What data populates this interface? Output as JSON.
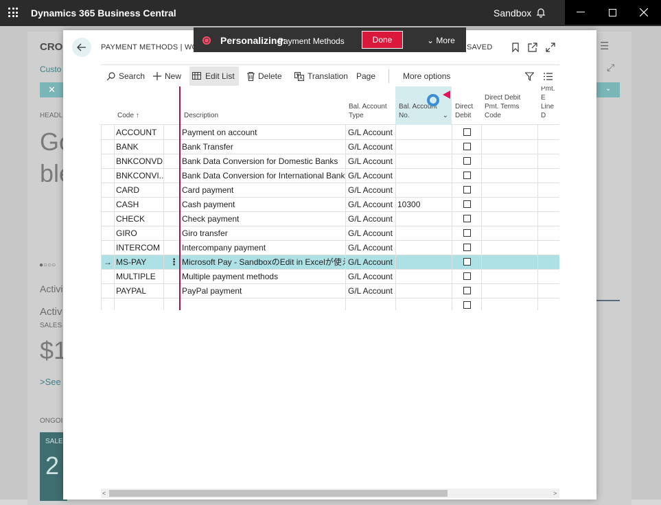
{
  "titlebar": {
    "app_title": "Dynamics 365 Business Central",
    "environment": "Sandbox",
    "icons": [
      "app-launcher-icon",
      "bell-icon",
      "minimize-icon",
      "maximize-icon",
      "close-icon"
    ]
  },
  "background": {
    "company": "CRO",
    "customer_link": "Custo",
    "headline_label": "HEADL",
    "headline_line1": "Go",
    "headline_line2": "ble",
    "activity_tab": "Activi",
    "activity_title": "Activ",
    "sales_label": "SALES",
    "amount": "$1",
    "see_more": "See",
    "ongoing": "ONGOI",
    "tile_label": "SALE",
    "tile_value": "2"
  },
  "personalize": {
    "label": "Personalizing:",
    "page": "Payment Methods",
    "done_label": "Done",
    "more_label": "More"
  },
  "dialog": {
    "title": "PAYMENT METHODS | WORK",
    "saved_label": "SAVED"
  },
  "toolbar": {
    "search": "Search",
    "new": "New",
    "edit_list": "Edit List",
    "delete": "Delete",
    "translation": "Translation",
    "page": "Page",
    "more_options": "More options"
  },
  "grid": {
    "headers": {
      "code": "Code",
      "code_sort": "↑",
      "description": "Description",
      "bal_type_1": "Bal. Account",
      "bal_type_2": "Type",
      "bal_no_1": "Bal. Account",
      "bal_no_2": "No.",
      "direct_debit_1": "Direct",
      "direct_debit_2": "Debit",
      "dd_terms_1": "Direct Debit",
      "dd_terms_2": "Pmt. Terms",
      "dd_terms_3": "Code",
      "pmt_export_1": "Pmt. E",
      "pmt_export_2": "Line D"
    },
    "rows": [
      {
        "code": "ACCOUNT",
        "description": "Payment on account",
        "type": "G/L Account",
        "no": ""
      },
      {
        "code": "BANK",
        "description": "Bank Transfer",
        "type": "G/L Account",
        "no": ""
      },
      {
        "code": "BNKCONVD...",
        "description": "Bank Data Conversion for Domestic Banks",
        "type": "G/L Account",
        "no": ""
      },
      {
        "code": "BNKCONVI...",
        "description": "Bank Data Conversion for International Banks",
        "type": "G/L Account",
        "no": ""
      },
      {
        "code": "CARD",
        "description": "Card payment",
        "type": "G/L Account",
        "no": ""
      },
      {
        "code": "CASH",
        "description": "Cash payment",
        "type": "G/L Account",
        "no": "10300"
      },
      {
        "code": "CHECK",
        "description": "Check payment",
        "type": "G/L Account",
        "no": ""
      },
      {
        "code": "GIRO",
        "description": "Giro transfer",
        "type": "G/L Account",
        "no": ""
      },
      {
        "code": "INTERCOM",
        "description": "Intercompany payment",
        "type": "G/L Account",
        "no": ""
      },
      {
        "code": "MS-PAY",
        "description": "Microsoft Pay - SandboxのEdit in Excelが使える",
        "type": "G/L Account",
        "no": ""
      },
      {
        "code": "MULTIPLE",
        "description": "Multiple payment methods",
        "type": "G/L Account",
        "no": ""
      },
      {
        "code": "PAYPAL",
        "description": "PayPal payment",
        "type": "G/L Account",
        "no": ""
      },
      {
        "code": "",
        "description": "",
        "type": "",
        "no": ""
      }
    ],
    "selected_row": 9
  },
  "colors": {
    "titlebar": "#2b2b2b",
    "accent_teal": "#aee1e5",
    "done_red": "#d8193c",
    "freeze_line": "#a5134e"
  }
}
